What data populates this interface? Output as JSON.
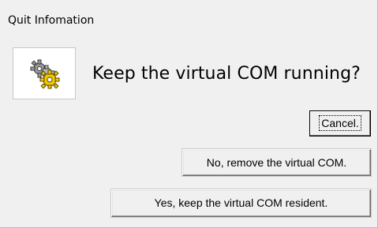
{
  "window": {
    "title": "Quit Infomation"
  },
  "message": {
    "icon": "gears-icon",
    "text": "Keep the virtual COM running?"
  },
  "buttons": {
    "cancel_label": "Cancel.",
    "no_label": "No, remove the virtual COM.",
    "yes_label": "Yes, keep the virtual COM resident."
  },
  "colors": {
    "background": "#f0f0f0",
    "gear_yellow": "#f2c800",
    "gear_gray": "#8a8a8a"
  }
}
